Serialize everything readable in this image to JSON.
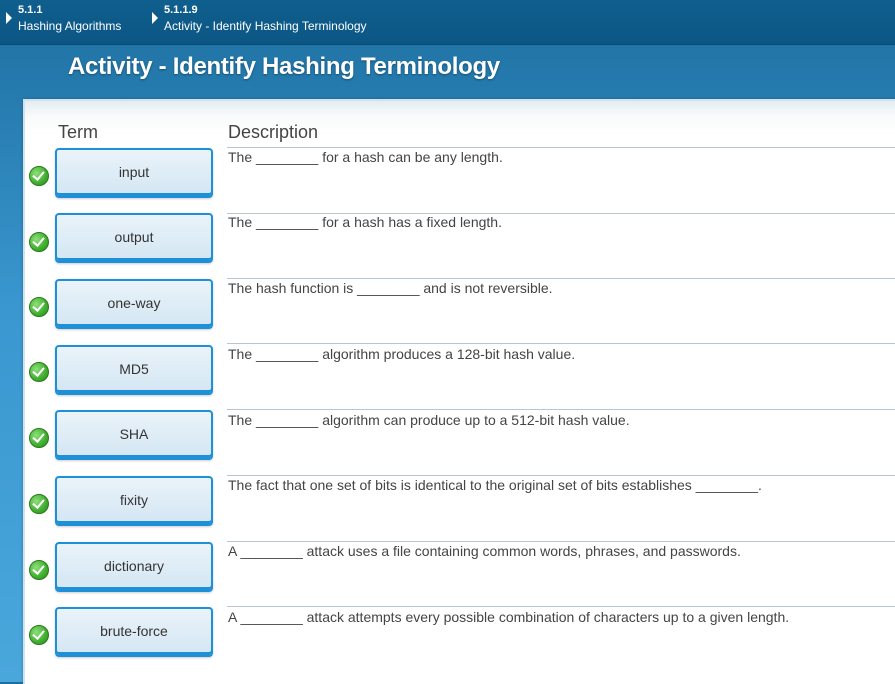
{
  "breadcrumbs": [
    {
      "number": "5.1.1",
      "label": "Hashing Algorithms"
    },
    {
      "number": "5.1.1.9",
      "label": "Activity - Identify Hashing Terminology"
    }
  ],
  "page_title": "Activity - Identify Hashing Terminology",
  "headers": {
    "term": "Term",
    "description": "Description"
  },
  "rows": [
    {
      "term": "input",
      "description": "The ________ for a hash can be any length.",
      "status": "correct"
    },
    {
      "term": "output",
      "description": "The ________ for a hash has a fixed length.",
      "status": "correct"
    },
    {
      "term": "one-way",
      "description": "The hash function is ________ and is not reversible.",
      "status": "correct"
    },
    {
      "term": "MD5",
      "description": "The ________ algorithm produces a 128-bit hash value.",
      "status": "correct"
    },
    {
      "term": "SHA",
      "description": "The ________ algorithm can produce up to a 512-bit hash value.",
      "status": "correct"
    },
    {
      "term": "fixity",
      "description": "The fact that one set of bits is identical to the original set of bits establishes ________.",
      "status": "correct"
    },
    {
      "term": "dictionary",
      "description": "A ________ attack uses a file containing common words, phrases, and passwords.",
      "status": "correct"
    },
    {
      "term": "brute-force",
      "description": "A ________ attack attempts every possible combination of characters up to a given length.",
      "status": "correct"
    }
  ],
  "icons": {
    "status": "check-circle-icon",
    "breadcrumb": "triangle-right-icon"
  },
  "colors": {
    "accent": "#1e90d8",
    "correct": "#3fae2e",
    "header_bar": "#0f5f8e"
  }
}
